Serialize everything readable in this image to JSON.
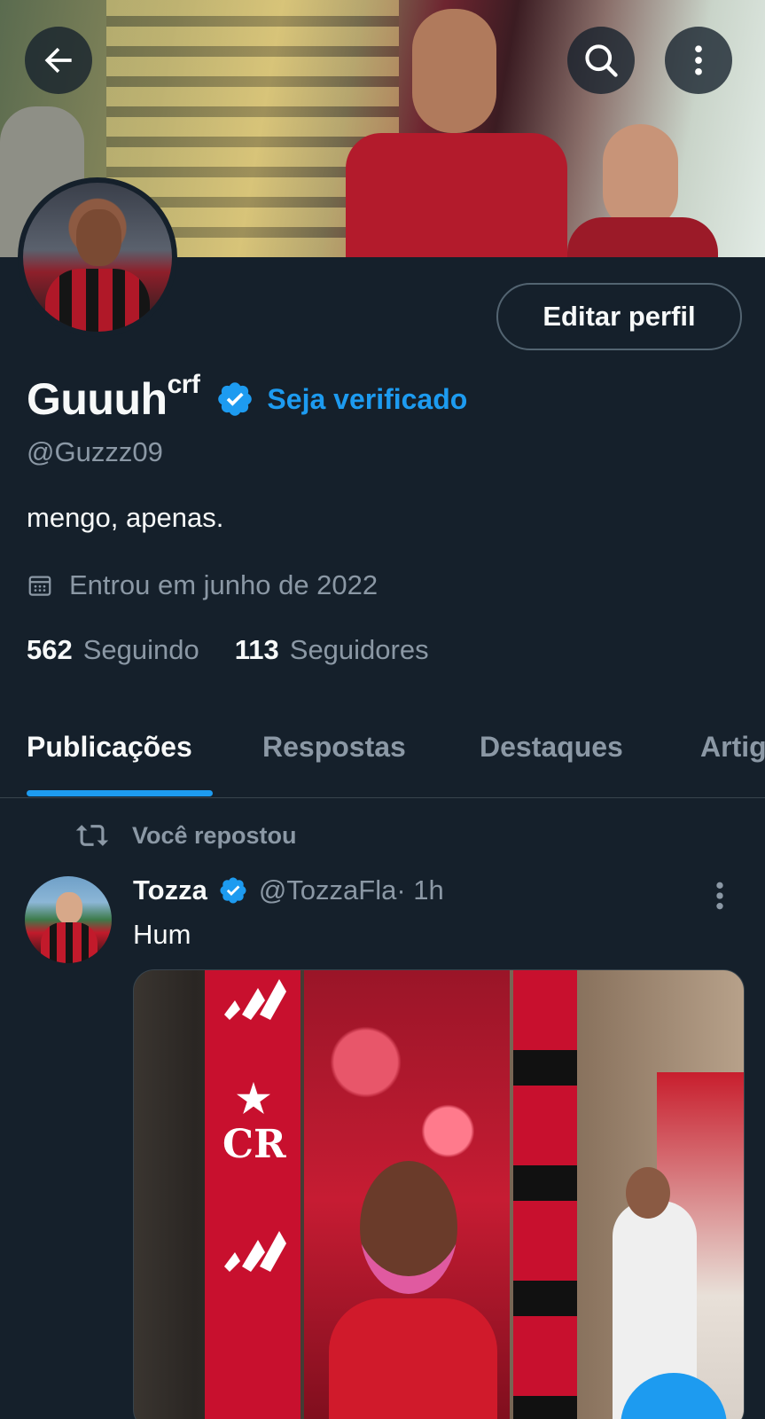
{
  "header": {
    "back_icon": "arrow-left-icon",
    "search_icon": "search-icon",
    "more_icon": "more-vertical-icon"
  },
  "profile": {
    "display_name": "Guuuh",
    "display_name_sup": "crf",
    "get_verified": "Seja verificado",
    "handle": "@Guzzz09",
    "bio": "mengo, apenas.",
    "joined": "Entrou em junho de 2022",
    "edit_button": "Editar perfil",
    "following_count": "562",
    "following_label": "Seguindo",
    "followers_count": "113",
    "followers_label": "Seguidores",
    "accent_color": "#1d9bf0"
  },
  "tabs": [
    {
      "label": "Publicações",
      "active": true
    },
    {
      "label": "Respostas",
      "active": false
    },
    {
      "label": "Destaques",
      "active": false
    },
    {
      "label": "Artig",
      "active": false
    }
  ],
  "feed": {
    "repost_label": "Você repostou",
    "post": {
      "author": "Tozza",
      "handle": "@TozzaFla",
      "time": " · 1h",
      "text": "Hum"
    }
  }
}
